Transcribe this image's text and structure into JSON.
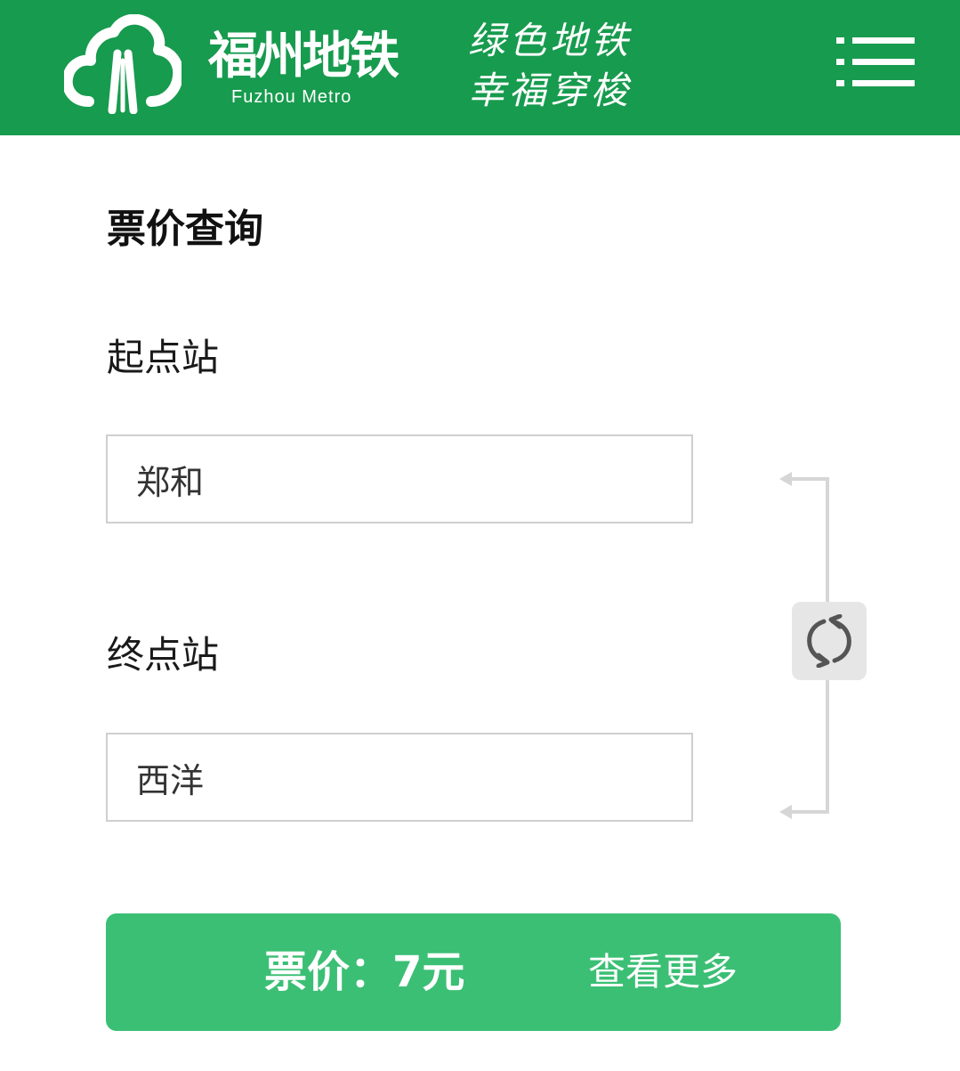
{
  "header": {
    "brand_cn": "福州地铁",
    "brand_en": "Fuzhou Metro",
    "slogan_line1": "绿色地铁",
    "slogan_line2": "幸福穿梭",
    "background_color": "#179b4e",
    "logo_icon": "cloud-tree-logo-icon",
    "menu_icon": "list-menu-icon"
  },
  "page": {
    "title": "票价查询"
  },
  "form": {
    "start_label": "起点站",
    "start_value": "郑和",
    "end_label": "终点站",
    "end_value": "西洋",
    "swap_icon": "swap-refresh-icon"
  },
  "result": {
    "fare_text": "票价：7元",
    "more_label": "查看更多",
    "background_color": "#3bbf74"
  }
}
